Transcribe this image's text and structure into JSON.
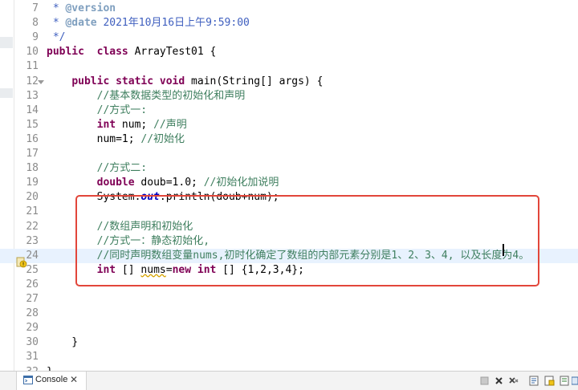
{
  "editor": {
    "lines": [
      {
        "n": "7",
        "fold": false,
        "current": false,
        "parts": [
          [
            "jd",
            " * "
          ],
          [
            "jt",
            "@version"
          ]
        ]
      },
      {
        "n": "8",
        "fold": false,
        "current": false,
        "parts": [
          [
            "jd",
            " * "
          ],
          [
            "jt",
            "@date"
          ],
          [
            "jd",
            " 2021年10月16日上午9:59:00"
          ]
        ]
      },
      {
        "n": "9",
        "fold": false,
        "current": false,
        "parts": [
          [
            "jd",
            " */"
          ]
        ]
      },
      {
        "n": "10",
        "fold": false,
        "current": false,
        "parts": [
          [
            "kw",
            "public"
          ],
          [
            "",
            "  "
          ],
          [
            "kw",
            "class"
          ],
          [
            "",
            " ArrayTest01 {"
          ]
        ]
      },
      {
        "n": "11",
        "fold": false,
        "current": false,
        "parts": []
      },
      {
        "n": "12",
        "fold": true,
        "current": false,
        "parts": [
          [
            "",
            "    "
          ],
          [
            "kw",
            "public"
          ],
          [
            "",
            " "
          ],
          [
            "kw",
            "static"
          ],
          [
            "",
            " "
          ],
          [
            "kw",
            "void"
          ],
          [
            "",
            " main(String[] args) {"
          ]
        ]
      },
      {
        "n": "13",
        "fold": false,
        "current": false,
        "parts": [
          [
            "",
            "        "
          ],
          [
            "cm",
            "//基本数据类型的初始化和声明"
          ]
        ]
      },
      {
        "n": "14",
        "fold": false,
        "current": false,
        "parts": [
          [
            "",
            "        "
          ],
          [
            "cm",
            "//方式一:"
          ]
        ]
      },
      {
        "n": "15",
        "fold": false,
        "current": false,
        "parts": [
          [
            "",
            "        "
          ],
          [
            "kw",
            "int"
          ],
          [
            "",
            " num; "
          ],
          [
            "cm",
            "//声明"
          ]
        ]
      },
      {
        "n": "16",
        "fold": false,
        "current": false,
        "parts": [
          [
            "",
            "        num=1; "
          ],
          [
            "cm",
            "//初始化"
          ]
        ]
      },
      {
        "n": "17",
        "fold": false,
        "current": false,
        "parts": []
      },
      {
        "n": "18",
        "fold": false,
        "current": false,
        "parts": [
          [
            "",
            "        "
          ],
          [
            "cm",
            "//方式二:"
          ]
        ]
      },
      {
        "n": "19",
        "fold": false,
        "current": false,
        "parts": [
          [
            "",
            "        "
          ],
          [
            "kw",
            "double"
          ],
          [
            "",
            " doub=1.0; "
          ],
          [
            "cm",
            "//初始化加说明"
          ]
        ]
      },
      {
        "n": "20",
        "fold": false,
        "current": false,
        "parts": [
          [
            "",
            "        System."
          ],
          [
            "st",
            "out"
          ],
          [
            "",
            ".println(doub+num);"
          ]
        ]
      },
      {
        "n": "21",
        "fold": false,
        "current": false,
        "parts": []
      },
      {
        "n": "22",
        "fold": false,
        "current": false,
        "parts": [
          [
            "",
            "        "
          ],
          [
            "cm",
            "//数组声明和初始化"
          ]
        ]
      },
      {
        "n": "23",
        "fold": false,
        "current": false,
        "parts": [
          [
            "",
            "        "
          ],
          [
            "cm",
            "//方式一：静态初始化,"
          ]
        ]
      },
      {
        "n": "24",
        "fold": false,
        "current": true,
        "parts": [
          [
            "",
            "        "
          ],
          [
            "cm",
            "//同时声明数组变量nums,初时化确定了数组的内部元素分别是1、2、3、4, 以及长度为4。"
          ]
        ]
      },
      {
        "n": "25",
        "fold": false,
        "current": false,
        "parts": [
          [
            "",
            "        "
          ],
          [
            "kw",
            "int"
          ],
          [
            "",
            " [] "
          ],
          [
            "sq",
            "nums"
          ],
          [
            "",
            "="
          ],
          [
            "kw",
            "new"
          ],
          [
            "",
            " "
          ],
          [
            "kw",
            "int"
          ],
          [
            "",
            " [] {1,2,3,4};"
          ]
        ]
      },
      {
        "n": "26",
        "fold": false,
        "current": false,
        "parts": []
      },
      {
        "n": "27",
        "fold": false,
        "current": false,
        "parts": []
      },
      {
        "n": "28",
        "fold": false,
        "current": false,
        "parts": []
      },
      {
        "n": "29",
        "fold": false,
        "current": false,
        "parts": []
      },
      {
        "n": "30",
        "fold": false,
        "current": false,
        "parts": [
          [
            "",
            "    }"
          ]
        ]
      },
      {
        "n": "31",
        "fold": false,
        "current": false,
        "parts": []
      },
      {
        "n": "32",
        "fold": false,
        "current": false,
        "parts": [
          [
            "",
            "}"
          ]
        ]
      }
    ]
  },
  "console": {
    "tab_label": "Console",
    "close_symbol": "✕"
  },
  "toolbar": {
    "icons": [
      "terminate-icon",
      "remove-launches-icon",
      "clear-console-icon",
      "scroll-lock-icon",
      "word-wrap-icon",
      "pin-console-icon",
      "display-selected-icon"
    ]
  },
  "colors": {
    "keyword": "#7f0055",
    "comment": "#3f7f5f",
    "javadoc": "#3f5fbf",
    "highlight_box": "#e2463a",
    "current_line": "#e8f2fe"
  }
}
